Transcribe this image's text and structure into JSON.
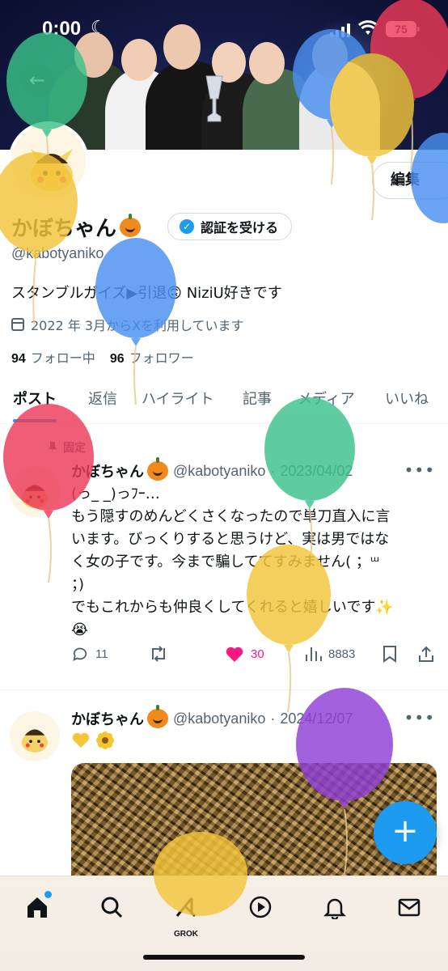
{
  "status_bar": {
    "time": "0:00",
    "battery": "75"
  },
  "profile": {
    "name": "かぼちゃん",
    "verify_label": "認証を受ける",
    "edit_label": "編集",
    "handle": "@kabotyaniko",
    "bio": "スタンブルガイズ▶︎引退🙃 NiziU好きです",
    "joined": "2022 年 3月からXを利用しています",
    "following_count": "94",
    "following_label": "フォロー中",
    "followers_count": "96",
    "followers_label": "フォロワー"
  },
  "tabs": [
    "ポスト",
    "返信",
    "ハイライト",
    "記事",
    "メディア",
    "いいね"
  ],
  "posts": [
    {
      "pinned_label": "固定",
      "author": "かぼちゃん",
      "handle": "@kabotyaniko",
      "date": "2023/04/02",
      "text_lines": [
        "(っ_ _)っﾌｰ…",
        "もう隠すのめんどくさくなったので単刀直入に言",
        "います。びっくりすると思うけど、実は男ではな",
        "く女の子です。今まで騙しててすみません( ；ᵚ",
        "；)",
        "でもこれからも仲良くしてくれると嬉しいです✨",
        "😭"
      ],
      "replies": "11",
      "likes": "30",
      "views": "8883"
    },
    {
      "author": "かぼちゃん",
      "handle": "@kabotyaniko",
      "date": "2024/12/07"
    }
  ],
  "nav": {
    "grok_label": "GROK"
  },
  "colors": {
    "accent": "#1d9bf0",
    "like": "#f91880",
    "text": "#0f1419",
    "muted": "#536471"
  },
  "icons": [
    "back-arrow-icon",
    "verify-badge-icon",
    "calendar-icon",
    "pin-icon",
    "reply-icon",
    "repost-icon",
    "heart-icon",
    "views-icon",
    "bookmark-icon",
    "share-icon",
    "more-icon",
    "home-icon",
    "search-icon",
    "grok-icon",
    "play-icon",
    "bell-icon",
    "mail-icon",
    "plus-icon"
  ]
}
